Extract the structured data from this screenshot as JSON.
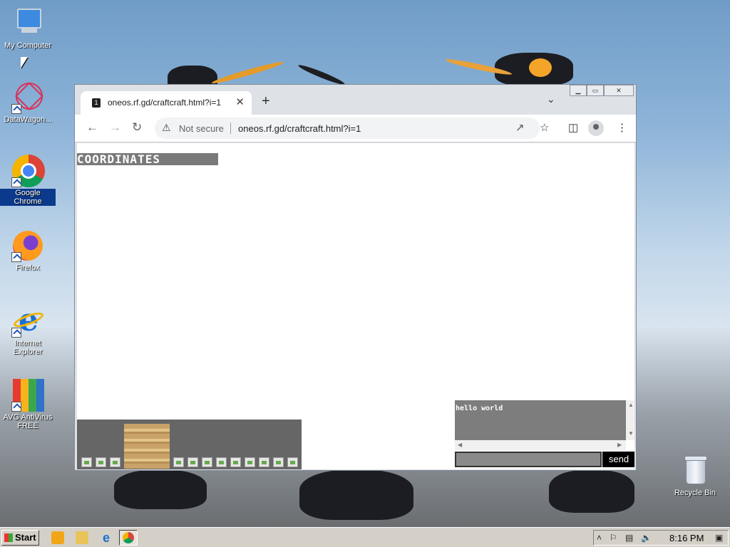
{
  "desktop": {
    "icons": [
      {
        "label": "My Computer",
        "icon": "computer-icon"
      },
      {
        "label": "DataWagon...",
        "icon": "datawagon-icon"
      },
      {
        "label": "Google Chrome",
        "icon": "chrome-icon"
      },
      {
        "label": "Firefox",
        "icon": "firefox-icon"
      },
      {
        "label": "Internet Explorer",
        "icon": "ie-icon"
      },
      {
        "label": "AVG AntiVirus FREE",
        "icon": "avg-icon"
      },
      {
        "label": "Recycle Bin",
        "icon": "recycle-bin-icon"
      }
    ]
  },
  "browser": {
    "tab_title": "oneos.rf.gd/craftcraft.html?i=1",
    "tab_close": "✕",
    "new_tab": "+",
    "security_label": "Not secure",
    "url": "oneos.rf.gd/craftcraft.html?i=1",
    "window_controls": [
      "▁",
      "▭",
      "✕"
    ]
  },
  "game": {
    "coordinates_label": "COORDINATES",
    "chat_log": "hello world",
    "chat_input_value": "",
    "send_label": "send"
  },
  "taskbar": {
    "start_label": "Start",
    "clock": "8:16 PM"
  },
  "colors": {
    "chrome_frame": "#dee1e6",
    "taskbar": "#d4d0c8",
    "selection": "#0b3a8c"
  }
}
